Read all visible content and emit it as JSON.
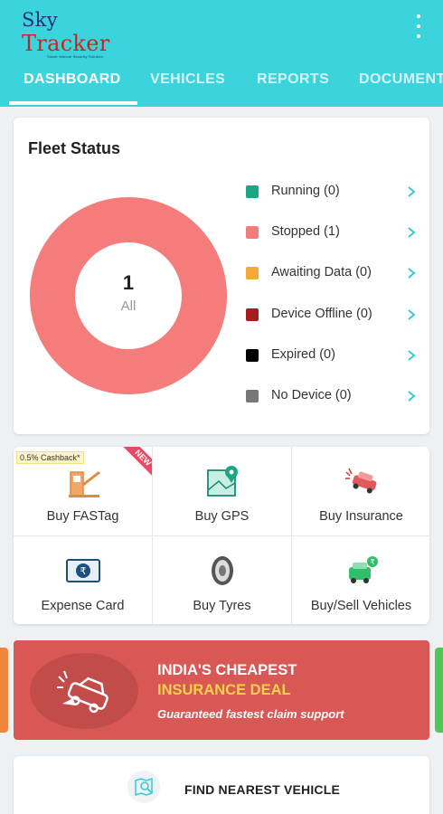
{
  "app": {
    "logo_text_a": "Sky ",
    "logo_text_b": "Tracker",
    "logo_tagline": "Smart Vehicle Security Solution"
  },
  "tabs": [
    {
      "label": "DASHBOARD",
      "active": true
    },
    {
      "label": "VEHICLES",
      "active": false
    },
    {
      "label": "REPORTS",
      "active": false
    },
    {
      "label": "DOCUMENTS",
      "active": false
    }
  ],
  "fleet": {
    "title": "Fleet Status",
    "total": "1",
    "total_label": "All",
    "legend": [
      {
        "label": "Running (0)",
        "count": 0,
        "color": "#1aa682"
      },
      {
        "label": "Stopped (1)",
        "count": 1,
        "color": "#f47c7a"
      },
      {
        "label": "Awaiting Data (0)",
        "count": 0,
        "color": "#f6a93b"
      },
      {
        "label": "Device Offline (0)",
        "count": 0,
        "color": "#a51c1c"
      },
      {
        "label": "Expired (0)",
        "count": 0,
        "color": "#000000"
      },
      {
        "label": "No Device (0)",
        "count": 0,
        "color": "#777777"
      }
    ]
  },
  "services": {
    "cashback_badge": "0.5% Cashback*",
    "new_ribbon": "NEW",
    "items": [
      {
        "label": "Buy FASTag",
        "icon": "fastag-toll-icon"
      },
      {
        "label": "Buy GPS",
        "icon": "gps-map-icon"
      },
      {
        "label": "Buy Insurance",
        "icon": "insurance-car-icon"
      },
      {
        "label": "Expense Card",
        "icon": "rupee-card-icon"
      },
      {
        "label": "Buy Tyres",
        "icon": "tyre-icon"
      },
      {
        "label": "Buy/Sell Vehicles",
        "icon": "vehicle-rupee-icon"
      }
    ]
  },
  "banner": {
    "line1": "INDIA'S CHEAPEST",
    "line2": "INSURANCE DEAL",
    "line3": "Guaranteed fastest claim support"
  },
  "find": {
    "label": "FIND NEAREST VEHICLE"
  },
  "colors": {
    "appbar": "#3bd3dc",
    "banner": "#d95856",
    "banner_highlight": "#f7d24a",
    "chevron": "#3bc7d3"
  }
}
